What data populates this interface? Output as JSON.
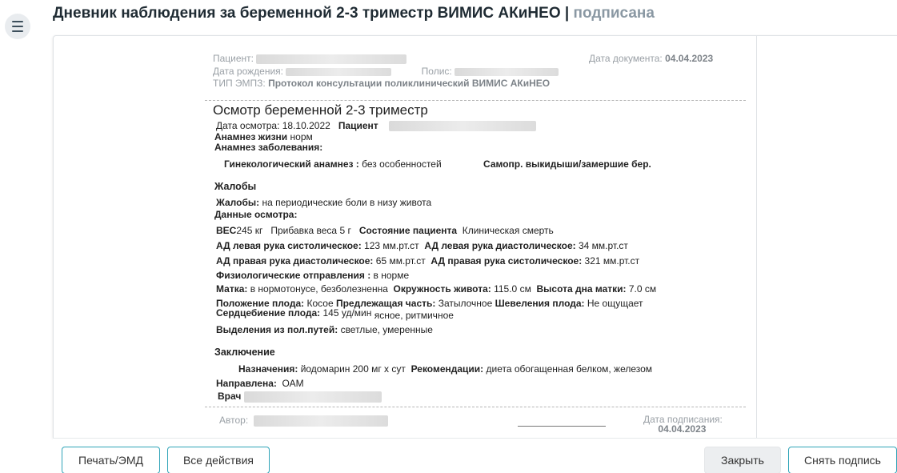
{
  "header": {
    "title": "Дневник наблюдения за беременной 2-3 триместр ВИМИС АКиНЕО |",
    "status": "подписана"
  },
  "doc": {
    "patient_label": "Пациент:",
    "birth_label": "Дата рождения:",
    "policy_label": "Полис:",
    "doc_date_label": "Дата документа:",
    "doc_date": "04.04.2023",
    "emz_label": "ТИП ЭМПЗ:",
    "emz_value": "Протокол консультации поликлинический ВИМИС АКиНЕО"
  },
  "exam": {
    "title": "Осмотр беременной 2-3 триместр",
    "date_text": "Дата осмотра: 18.10.2022",
    "patient_label": "Пациент",
    "life_anamnesis_label": "Анамнез жизни",
    "life_anamnesis_value": "норм",
    "disease_anamnesis_label": "Анамнез заболевания:",
    "gyn_label": "Гинекологический анамнез :",
    "gyn_value": "без особенностей",
    "miscarriage_label": "Самопр. выкидыши/замершие бер.",
    "complaints_section": "Жалобы",
    "complaints_label": "Жалобы:",
    "complaints_value": "на периодические боли в низу живота",
    "exam_data_label": "Данные осмотра:",
    "weight_label": "ВЕС",
    "weight_value": "245 кг",
    "gain_label": "Прибавка веса",
    "gain_value": "5 г",
    "state_label": "Состояние пациента",
    "state_value": "Клиническая смерть",
    "bp_left_sys_label": "АД левая рука систолическое:",
    "bp_left_sys_value": "123 мм.рт.ст",
    "bp_left_dia_label": "АД левая рука диастолическое:",
    "bp_left_dia_value": "34 мм.рт.ст",
    "bp_right_dia_label": "АД правая рука диастолическое:",
    "bp_right_dia_value": "65 мм.рт.ст",
    "bp_right_sys_label": "АД правая рука систолическое:",
    "bp_right_sys_value": "321 мм.рт.ст",
    "physio_label": "Физиологические отправления :",
    "physio_value": "в норме",
    "uterus_label": "Матка:",
    "uterus_value": "в нормотонусе, безболезненна",
    "belly_label": "Окружность живота:",
    "belly_value": "115.0 см",
    "fundus_label": "Высота дна матки:",
    "fundus_value": "7.0 см",
    "position_label": "Положение плода:",
    "position_value": "Косое",
    "presenting_label": "Предлежащая часть:",
    "presenting_value": "Затылочное",
    "movement_label": "Шевеления плода:",
    "movement_value": "Не ощущает",
    "heartbeat_label": "Сердцебиение плода:",
    "heartbeat_value": "145 уд/мин",
    "heartbeat_note": "ясное, ритмичное",
    "discharge_label": "Выделения из пол.путей:",
    "discharge_value": "светлые, умеренные",
    "conclusion_section": "Заключение",
    "prescription_label": "Назначения:",
    "prescription_value": "йодомарин 200 мг х сут",
    "recommend_label": "Рекомендации:",
    "recommend_value": "диета обогащенная белком, железом",
    "referral_label": "Направлена:",
    "referral_value": "ОАМ",
    "doctor_label": "Врач"
  },
  "sign": {
    "author_label": "Автор:",
    "sign_date_label": "Дата подписания:",
    "sign_date": "04.04.2023"
  },
  "footer": {
    "print_label": "Печать/ЭМД",
    "actions_label": "Все действия",
    "close_label": "Закрыть",
    "unsign_label": "Снять подпись"
  }
}
